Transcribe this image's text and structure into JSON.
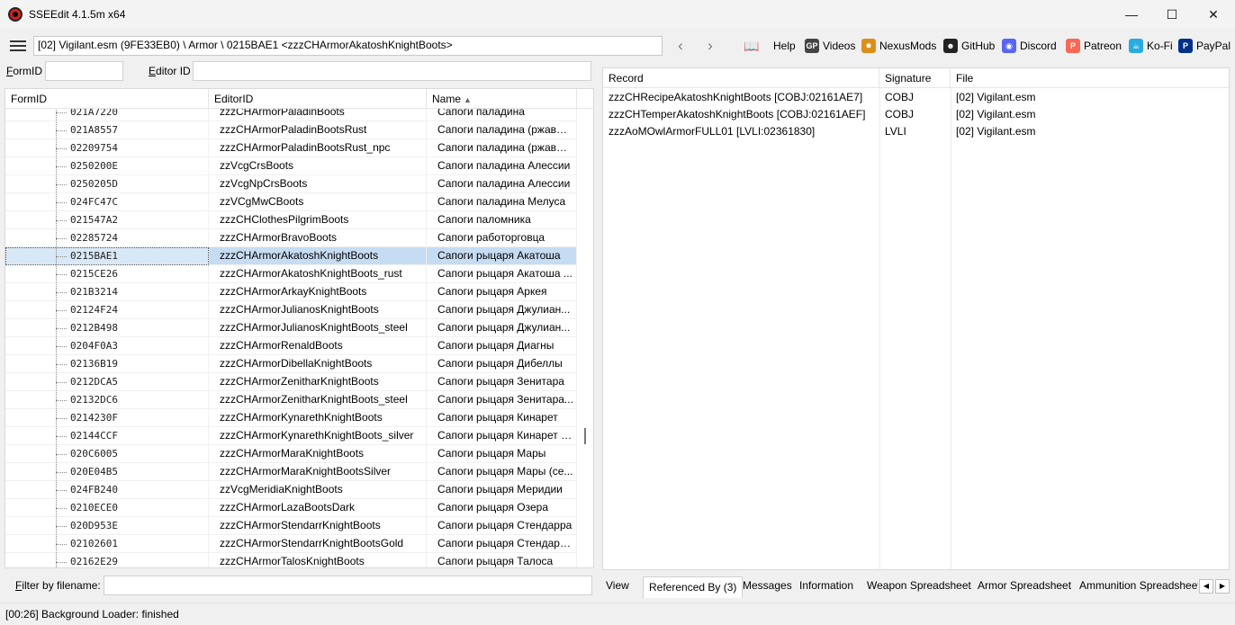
{
  "window": {
    "title": "SSEEdit 4.1.5m x64",
    "controls": {
      "minimize": "—",
      "maximize": "☐",
      "close": "✕"
    }
  },
  "toolbar": {
    "path": "[02] Vigilant.esm (9FE33EB0) \\ Armor \\ 0215BAE1 <zzzCHArmorAkatoshKnightBoots>",
    "back": "‹",
    "forward": "›",
    "links": [
      {
        "label": "Help",
        "icon": "book-icon",
        "glyph": "📖",
        "color": "#8b5a2b"
      },
      {
        "label": "Videos",
        "icon": "gp-icon",
        "glyph": "GP",
        "color": "#444444"
      },
      {
        "label": "NexusMods",
        "icon": "nexus-icon",
        "glyph": "✸",
        "color": "#d98f1a"
      },
      {
        "label": "GitHub",
        "icon": "github-icon",
        "glyph": "☻",
        "color": "#222222"
      },
      {
        "label": "Discord",
        "icon": "discord-icon",
        "glyph": "◉",
        "color": "#5865f2"
      },
      {
        "label": "Patreon",
        "icon": "patreon-icon",
        "glyph": "P",
        "color": "#f96854"
      },
      {
        "label": "Ko-Fi",
        "icon": "kofi-icon",
        "glyph": "☕",
        "color": "#29abe0"
      },
      {
        "label": "PayPal",
        "icon": "paypal-icon",
        "glyph": "P",
        "color": "#003087"
      }
    ]
  },
  "filters": {
    "formid_label_u": "F",
    "formid_label_rest": "ormID",
    "formid_value": "",
    "editorid_label_u": "E",
    "editorid_label_rest": "ditor ID",
    "editorid_value": "",
    "filename_label_u": "F",
    "filename_label_rest": "ilter by filename:",
    "filename_value": ""
  },
  "tree": {
    "columns": [
      "FormID",
      "EditorID",
      "Name"
    ],
    "sort_indicator": "▲",
    "rows": [
      {
        "formid": "021A7220",
        "editorid": "zzzCHArmorPaladinBoots",
        "name": "Сапоги паладина"
      },
      {
        "formid": "021A8557",
        "editorid": "zzzCHArmorPaladinBootsRust",
        "name": "Сапоги паладина (ржавые)"
      },
      {
        "formid": "02209754",
        "editorid": "zzzCHArmorPaladinBootsRust_npc",
        "name": "Сапоги паладина (ржавые)"
      },
      {
        "formid": "0250200E",
        "editorid": "zzVcgCrsBoots",
        "name": "Сапоги паладина Алессии"
      },
      {
        "formid": "0250205D",
        "editorid": "zzVcgNpCrsBoots",
        "name": "Сапоги паладина Алессии"
      },
      {
        "formid": "024FC47C",
        "editorid": "zzVCgMwCBoots",
        "name": "Сапоги паладина Мелуса"
      },
      {
        "formid": "021547A2",
        "editorid": "zzzCHClothesPilgrimBoots",
        "name": "Сапоги паломника"
      },
      {
        "formid": "02285724",
        "editorid": "zzzCHArmorBravoBoots",
        "name": "Сапоги работорговца"
      },
      {
        "formid": "0215BAE1",
        "editorid": "zzzCHArmorAkatoshKnightBoots",
        "name": "Сапоги рыцаря Акатоша",
        "selected": true
      },
      {
        "formid": "0215CE26",
        "editorid": "zzzCHArmorAkatoshKnightBoots_rust",
        "name": "Сапоги рыцаря Акатоша ..."
      },
      {
        "formid": "021B3214",
        "editorid": "zzzCHArmorArkayKnightBoots",
        "name": "Сапоги рыцаря Аркея"
      },
      {
        "formid": "02124F24",
        "editorid": "zzzCHArmorJulianosKnightBoots",
        "name": "Сапоги рыцаря Джулиан..."
      },
      {
        "formid": "0212B498",
        "editorid": "zzzCHArmorJulianosKnightBoots_steel",
        "name": "Сапоги рыцаря Джулиан..."
      },
      {
        "formid": "0204F0A3",
        "editorid": "zzzCHArmorRenaldBoots",
        "name": "Сапоги рыцаря Диагны"
      },
      {
        "formid": "02136B19",
        "editorid": "zzzCHArmorDibellaKnightBoots",
        "name": "Сапоги рыцаря Дибеллы"
      },
      {
        "formid": "0212DCA5",
        "editorid": "zzzCHArmorZenitharKnightBoots",
        "name": "Сапоги рыцаря Зенитара"
      },
      {
        "formid": "02132DC6",
        "editorid": "zzzCHArmorZenitharKnightBoots_steel",
        "name": "Сапоги рыцаря Зенитара..."
      },
      {
        "formid": "0214230F",
        "editorid": "zzzCHArmorKynarethKnightBoots",
        "name": "Сапоги рыцаря Кинарет"
      },
      {
        "formid": "02144CCF",
        "editorid": "zzzCHArmorKynarethKnightBoots_silver",
        "name": "Сапоги рыцаря Кинарет (..."
      },
      {
        "formid": "020C6005",
        "editorid": "zzzCHArmorMaraKnightBoots",
        "name": "Сапоги рыцаря Мары"
      },
      {
        "formid": "020E04B5",
        "editorid": "zzzCHArmorMaraKnightBootsSilver",
        "name": "Сапоги рыцаря Мары (се..."
      },
      {
        "formid": "024FB240",
        "editorid": "zzVcgMeridiaKnightBoots",
        "name": "Сапоги рыцаря Меридии"
      },
      {
        "formid": "0210ECE0",
        "editorid": "zzzCHArmorLazaBootsDark",
        "name": "Сапоги рыцаря Озера"
      },
      {
        "formid": "020D953E",
        "editorid": "zzzCHArmorStendarrKnightBoots",
        "name": "Сапоги рыцаря Стендарра"
      },
      {
        "formid": "02102601",
        "editorid": "zzzCHArmorStendarrKnightBootsGold",
        "name": "Сапоги рыцаря Стендарр..."
      },
      {
        "formid": "02162E29",
        "editorid": "zzzCHArmorTalosKnightBoots",
        "name": "Сапоги рыцаря Талоса"
      }
    ]
  },
  "references": {
    "columns": [
      "Record",
      "Signature",
      "File"
    ],
    "rows": [
      {
        "record": "zzzCHRecipeAkatoshKnightBoots [COBJ:02161AE7]",
        "signature": "COBJ",
        "file": "[02] Vigilant.esm"
      },
      {
        "record": "zzzCHTemperAkatoshKnightBoots [COBJ:02161AEF]",
        "signature": "COBJ",
        "file": "[02] Vigilant.esm"
      },
      {
        "record": "zzzAoMOwlArmorFULL01 [LVLI:02361830]",
        "signature": "LVLI",
        "file": "[02] Vigilant.esm"
      }
    ]
  },
  "tabs": [
    "View",
    "Referenced By (3)",
    "Messages",
    "Information",
    "Weapon Spreadsheet",
    "Armor Spreadsheet",
    "Ammunition Spreadsheet"
  ],
  "tab_scroll": {
    "left": "◀",
    "right": "▶"
  },
  "status": "[00:26] Background Loader: finished"
}
